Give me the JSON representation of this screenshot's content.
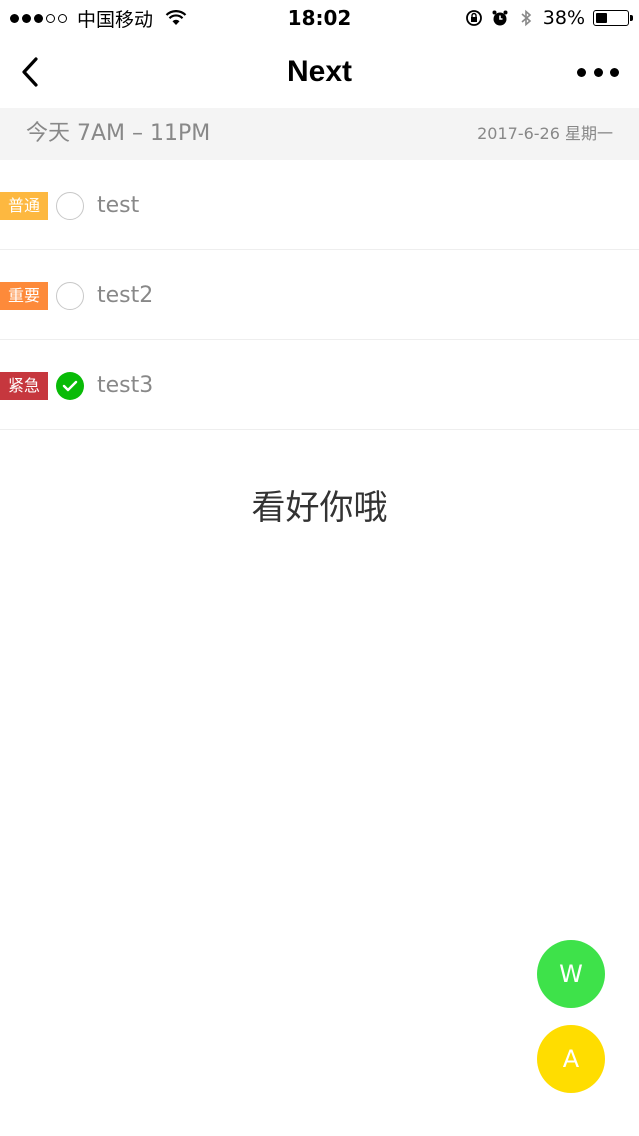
{
  "status_bar": {
    "carrier": "中国移动",
    "time": "18:02",
    "battery_percent_text": "38%",
    "battery_level": 0.38,
    "signal_bars_filled": 3,
    "signal_bars_total": 5
  },
  "nav": {
    "title": "Next",
    "back_icon": "chevron-left-icon",
    "more_icon": "more-horizontal-icon"
  },
  "date_header": {
    "range": "今天 7AM – 11PM",
    "date": "2017-6-26 星期一"
  },
  "tasks": [
    {
      "tag": "普通",
      "tag_color": "#fdb840",
      "title": "test",
      "done": false
    },
    {
      "tag": "重要",
      "tag_color": "#fd8a3a",
      "title": "test2",
      "done": false
    },
    {
      "tag": "紧急",
      "tag_color": "#c6373e",
      "title": "test3",
      "done": true
    }
  ],
  "motto": "看好你哦",
  "fabs": [
    {
      "label": "W",
      "color": "#3ee24a"
    },
    {
      "label": "A",
      "color": "#ffdd00"
    }
  ],
  "colors": {
    "check_green": "#09bb07",
    "date_header_bg": "#f4f4f4"
  }
}
